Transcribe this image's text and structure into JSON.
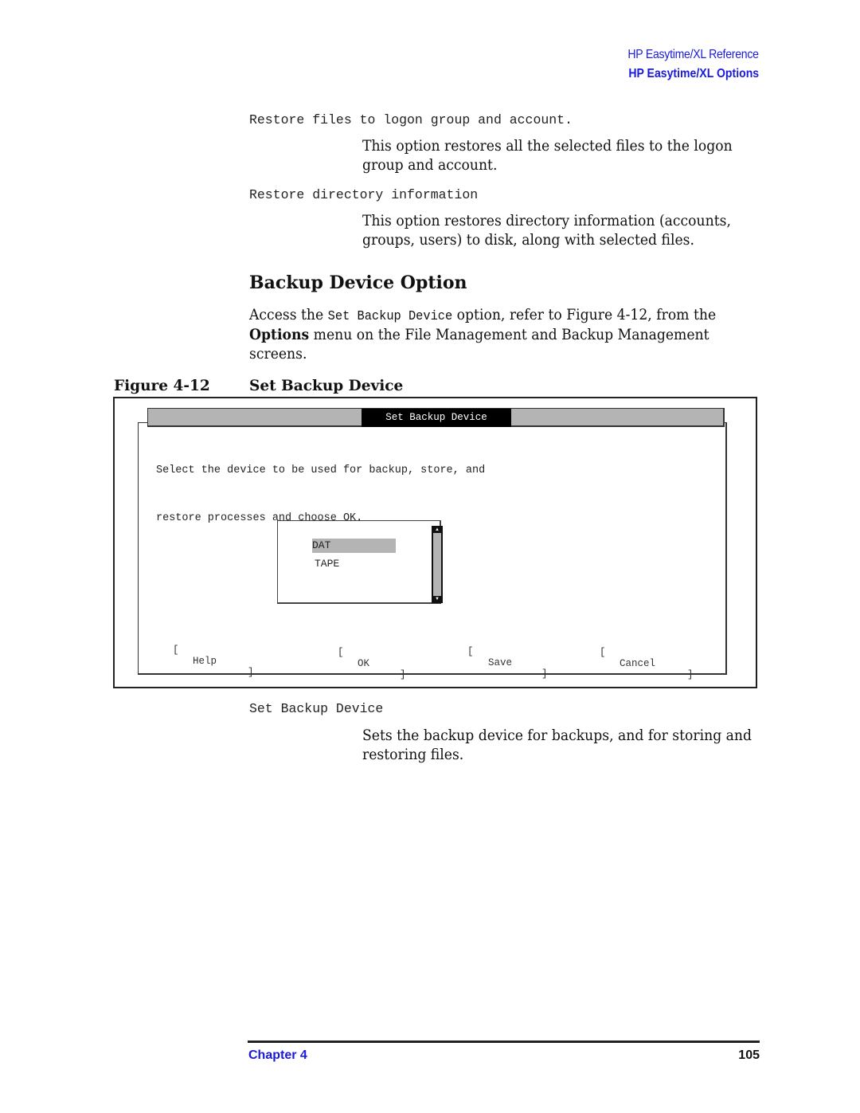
{
  "header": {
    "reference": "HP Easytime/XL Reference",
    "section": "HP Easytime/XL Options"
  },
  "options": [
    {
      "term": "Restore files to logon group and account.",
      "description_lines": [
        "This option restores all the selected files to the logon",
        "group and account."
      ]
    },
    {
      "term": "Restore directory information",
      "description_lines": [
        "This option restores directory information (accounts,",
        "groups, users) to disk, along with selected files."
      ]
    }
  ],
  "section": {
    "heading": "Backup Device Option",
    "para": {
      "line1_pre": "Access the ",
      "line1_code": "Set Backup Device",
      "line1_post": " option, refer to Figure 4-12, from the",
      "line2_bold": "Options",
      "line2_post": " menu on the File Management and Backup Management",
      "line3": "screens."
    }
  },
  "figure": {
    "number": "Figure 4-12",
    "caption": "Set Backup Device",
    "dialog": {
      "title": "Set Backup Device",
      "instructions": [
        "Select the device to be used for backup, store, and",
        "restore processes and choose OK."
      ],
      "list": {
        "items": [
          "DAT",
          "TAPE"
        ],
        "selected": "DAT"
      },
      "buttons": [
        {
          "label": "Help"
        },
        {
          "label": "OK"
        },
        {
          "label": "Save"
        },
        {
          "label": "Cancel"
        }
      ],
      "bracket_open": "[",
      "bracket_close": "]",
      "scroll_up": "▲",
      "scroll_down": "▼"
    }
  },
  "definition": {
    "term": "Set Backup Device",
    "description_lines": [
      "Sets the backup device for backups, and for storing and",
      "restoring files."
    ]
  },
  "footer": {
    "chapter": "Chapter 4",
    "page": "105"
  },
  "colors": {
    "link_blue": "#1a1adb",
    "dialog_gray": "#b4b4b4"
  }
}
